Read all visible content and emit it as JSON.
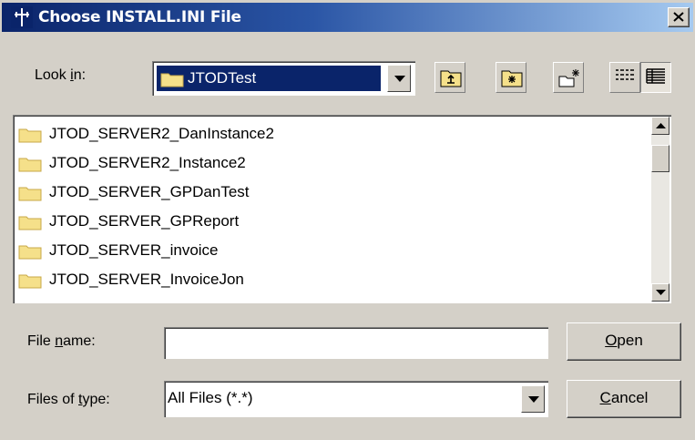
{
  "window": {
    "title": "Choose INSTALL.INI File",
    "close_icon": "close-icon"
  },
  "look_in": {
    "label_pre": "Look ",
    "label_mnemonic": "i",
    "label_post": "n:",
    "value": "JTODTest"
  },
  "toolbar": {
    "buttons": [
      {
        "icon": "up-one-level-icon"
      },
      {
        "icon": "home-folder-icon"
      },
      {
        "icon": "new-folder-icon"
      },
      {
        "icon": "list-view-icon"
      },
      {
        "icon": "details-view-icon"
      }
    ]
  },
  "file_list": {
    "items": [
      {
        "name": "JTOD_SERVER2_DanInstance2"
      },
      {
        "name": "JTOD_SERVER2_Instance2"
      },
      {
        "name": "JTOD_SERVER_GPDanTest"
      },
      {
        "name": "JTOD_SERVER_GPReport"
      },
      {
        "name": "JTOD_SERVER_invoice"
      },
      {
        "name": "JTOD_SERVER_InvoiceJon"
      }
    ]
  },
  "file_name": {
    "label_pre": "File ",
    "label_mnemonic": "n",
    "label_post": "ame:",
    "value": ""
  },
  "file_type": {
    "label_pre": "Files of ",
    "label_mnemonic": "t",
    "label_post": "ype:",
    "value": "All Files (*.*)"
  },
  "buttons": {
    "open_mnemonic": "O",
    "open_rest": "pen",
    "cancel_mnemonic": "C",
    "cancel_rest": "ancel"
  },
  "colors": {
    "title_gradient_start": "#0a246a",
    "title_gradient_end": "#a6caf0",
    "selection": "#0a246a",
    "folder_yellow": "#f5e08a",
    "dialog_bg": "#d4d0c8"
  }
}
